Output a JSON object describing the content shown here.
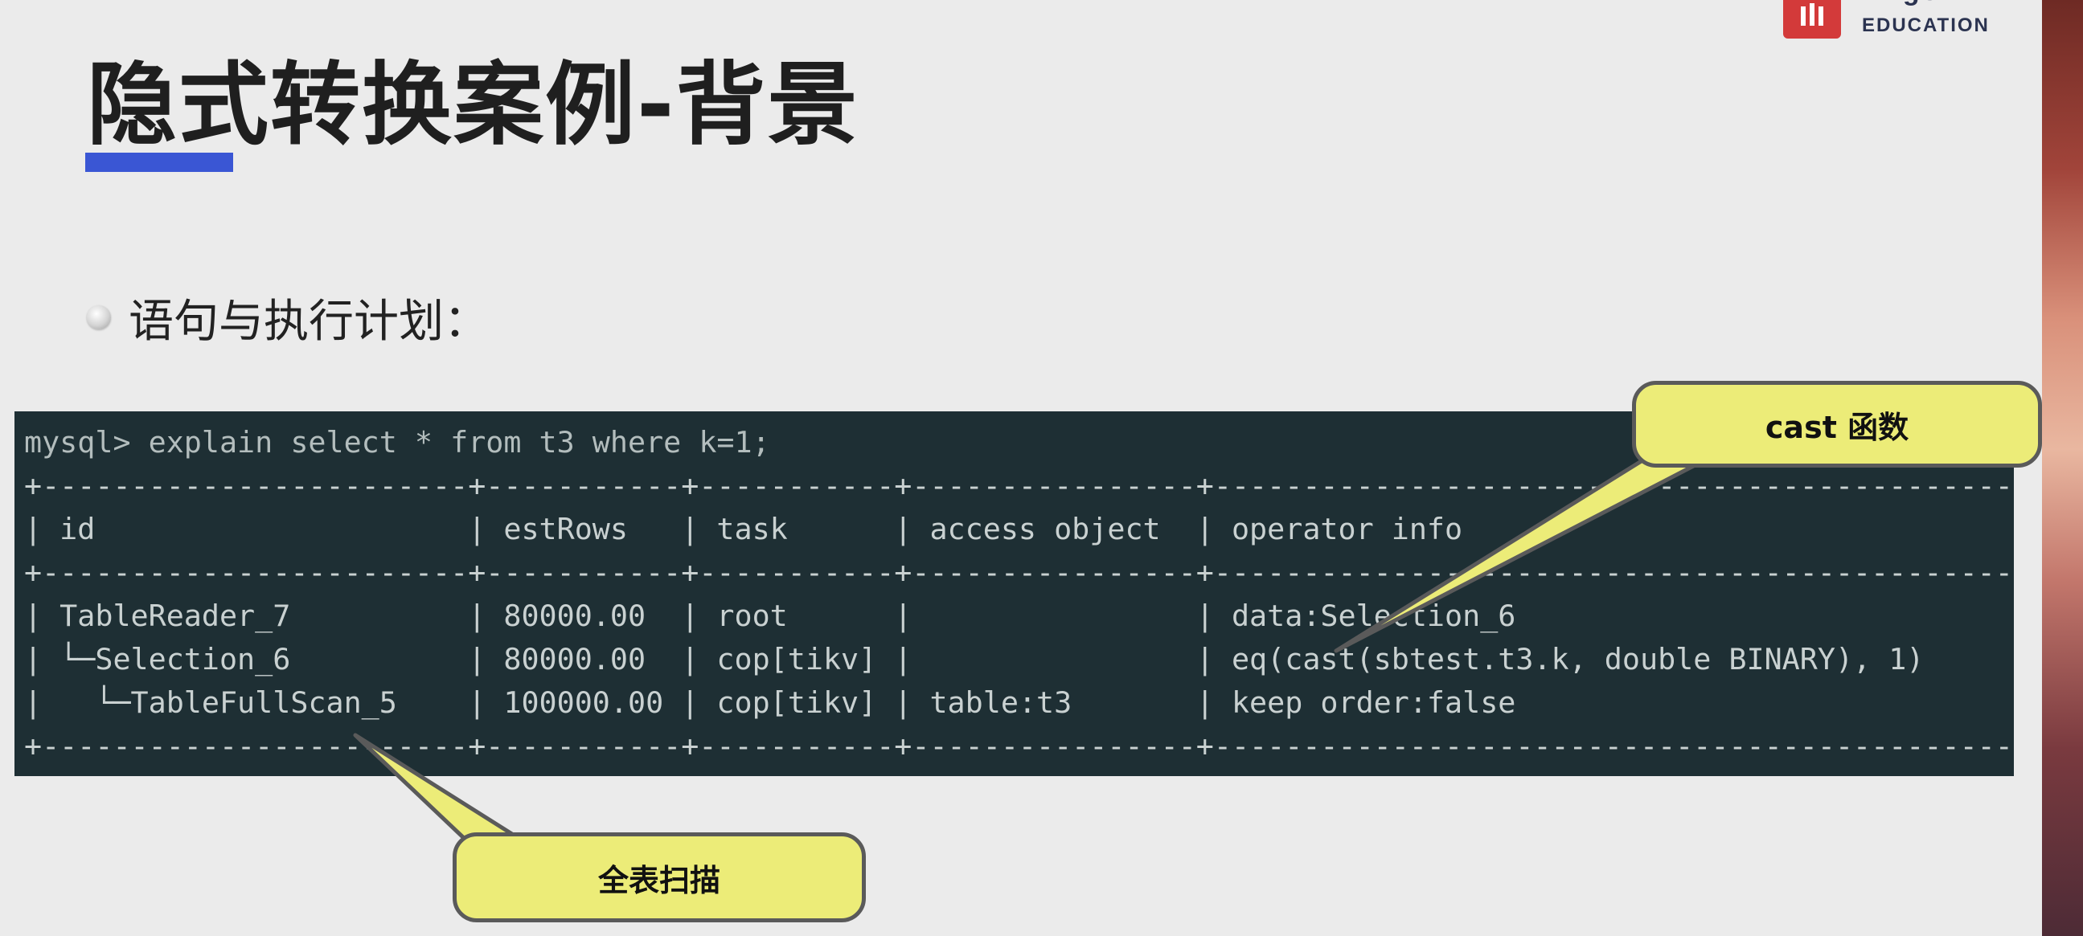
{
  "slide": {
    "title": "隐式转换案例-背景",
    "bullet": "语句与执行计划："
  },
  "logo": {
    "top_text": "PingCAP",
    "sub_text": "EDUCATION"
  },
  "terminal": {
    "lines": [
      "mysql> explain select * from t3 where k=1;",
      "+------------------------+-----------+-----------+----------------+---------------------------------------------+",
      "| id                     | estRows   | task      | access object  | operator info                               |",
      "+------------------------+-----------+-----------+----------------+---------------------------------------------+",
      "| TableReader_7          | 80000.00  | root      |                | data:Selection_6                            |",
      "| └─Selection_6          | 80000.00  | cop[tikv] |                | eq(cast(sbtest.t3.k, double BINARY), 1)     |",
      "|   └─TableFullScan_5    | 100000.00 | cop[tikv] | table:t3       | keep order:false                            |",
      "+------------------------+-----------+-----------+----------------+---------------------------------------------+"
    ]
  },
  "callouts": {
    "cast": "cast 函数",
    "scan": "全表扫描"
  },
  "colors": {
    "title_bar": "#3a56d4",
    "terminal_bg": "#1e2f34",
    "callout_fill": "#ecec78",
    "logo_red": "#d33a3a"
  }
}
